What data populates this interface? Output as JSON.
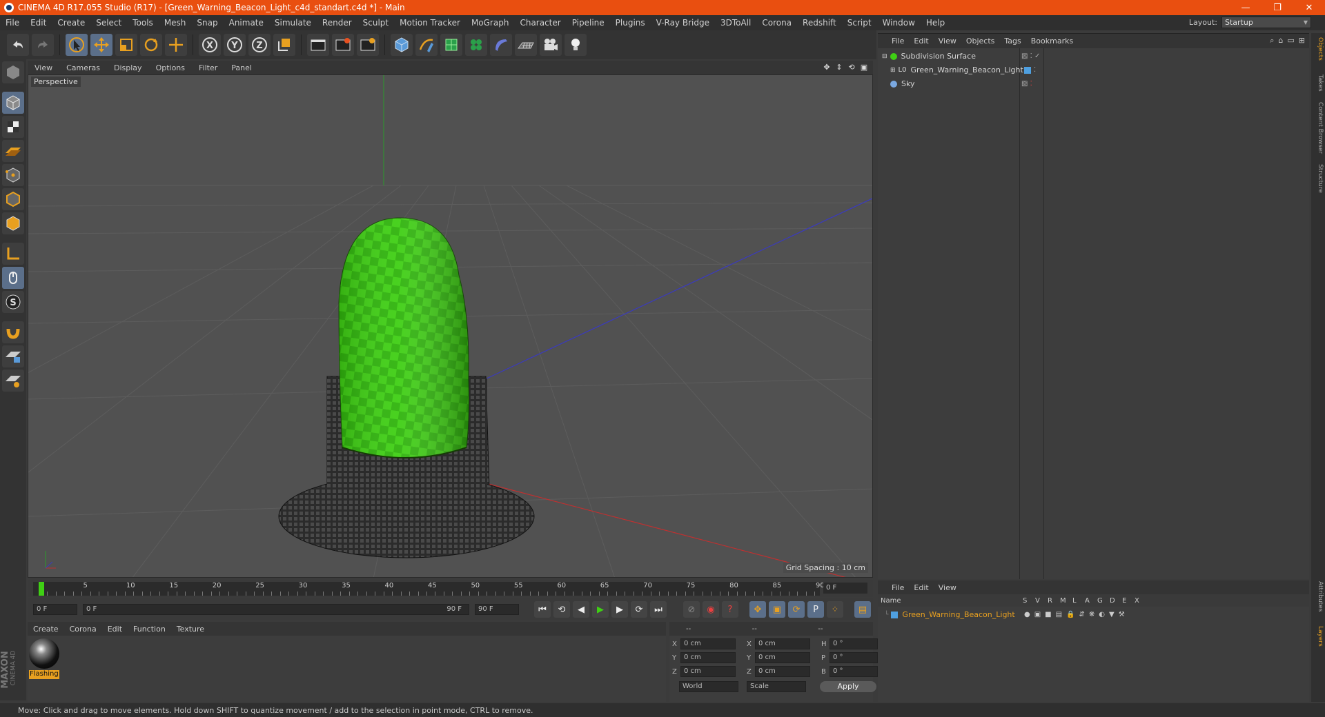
{
  "window": {
    "title": "CINEMA 4D R17.055 Studio (R17) - [Green_Warning_Beacon_Light_c4d_standart.c4d *] - Main",
    "minimize": "—",
    "maximize": "❐",
    "close": "✕"
  },
  "menu": [
    "File",
    "Edit",
    "Create",
    "Select",
    "Tools",
    "Mesh",
    "Snap",
    "Animate",
    "Simulate",
    "Render",
    "Sculpt",
    "Motion Tracker",
    "MoGraph",
    "Character",
    "Pipeline",
    "Plugins",
    "V-Ray Bridge",
    "3DToAll",
    "Corona",
    "Redshift",
    "Script",
    "Window",
    "Help"
  ],
  "layout": {
    "label": "Layout:",
    "value": "Startup"
  },
  "toolbar": {
    "icons": [
      "undo-icon",
      "redo-icon",
      "select-arrow-icon",
      "move-icon",
      "scale-icon",
      "rotate-icon",
      "transform-icon",
      "x-axis-icon",
      "y-axis-icon",
      "z-axis-icon",
      "coordinate-system-icon",
      "render-view-icon",
      "render-picture-viewer-icon",
      "render-settings-icon",
      "cube-icon",
      "pen-icon",
      "subdivision-icon",
      "mograph-cloner-icon",
      "deformer-icon",
      "floor-icon",
      "camera-icon",
      "light-icon"
    ]
  },
  "viewport": {
    "menu": [
      "View",
      "Cameras",
      "Display",
      "Options",
      "Filter",
      "Panel"
    ],
    "label": "Perspective",
    "grid_spacing": "Grid Spacing : 10 cm"
  },
  "timeline": {
    "ticks": [
      "0",
      "5",
      "10",
      "15",
      "20",
      "25",
      "30",
      "35",
      "40",
      "45",
      "50",
      "55",
      "60",
      "65",
      "70",
      "75",
      "80",
      "85",
      "90"
    ],
    "current_frame": "0 F"
  },
  "transport": {
    "start_field": "0 F",
    "range_min": "0 F",
    "range_max": "90 F",
    "end_field": "90 F"
  },
  "material_manager": {
    "menu": [
      "Create",
      "Corona",
      "Edit",
      "Function",
      "Texture"
    ],
    "material_name": "Flashing"
  },
  "coordinates": {
    "headers": [
      "--",
      "--",
      "--"
    ],
    "rows": [
      {
        "a": "X",
        "av": "0 cm",
        "b": "X",
        "bv": "0 cm",
        "c": "H",
        "cv": "0 °"
      },
      {
        "a": "Y",
        "av": "0 cm",
        "b": "Y",
        "bv": "0 cm",
        "c": "P",
        "cv": "0 °"
      },
      {
        "a": "Z",
        "av": "0 cm",
        "b": "Z",
        "bv": "0 cm",
        "c": "B",
        "cv": "0 °"
      }
    ],
    "mode1": "World",
    "mode2": "Scale",
    "apply": "Apply"
  },
  "objects": {
    "menu": [
      "File",
      "Edit",
      "View",
      "Objects",
      "Tags",
      "Bookmarks"
    ],
    "items": [
      {
        "name": "Subdivision Surface"
      },
      {
        "name": "Green_Warning_Beacon_Light"
      },
      {
        "name": "Sky"
      }
    ]
  },
  "side_tabs": [
    "Objects",
    "Takes",
    "Content Browser",
    "Structure",
    "Attributes",
    "Layers"
  ],
  "layers": {
    "menu": [
      "File",
      "Edit",
      "View"
    ],
    "columns": [
      "Name",
      "S",
      "V",
      "R",
      "M",
      "L",
      "A",
      "G",
      "D",
      "E",
      "X"
    ],
    "items": [
      {
        "name": "Green_Warning_Beacon_Light"
      }
    ]
  },
  "brand": {
    "line1": "MAXON",
    "line2": "CINEMA 4D"
  },
  "status": "Move: Click and drag to move elements. Hold down SHIFT to quantize movement / add to the selection in point mode, CTRL to remove."
}
